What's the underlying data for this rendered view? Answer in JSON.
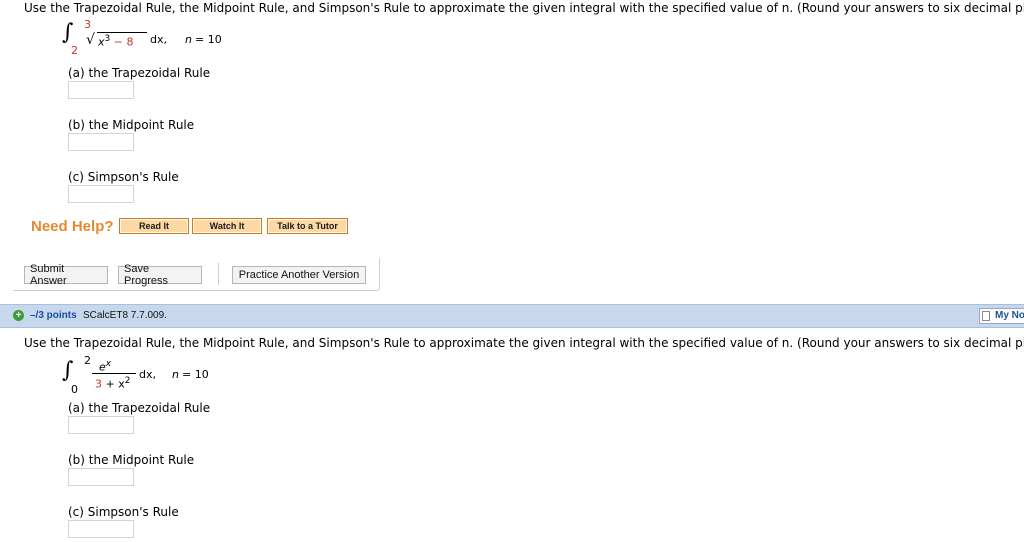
{
  "question1": {
    "instructions": "Use the Trapezoidal Rule, the Midpoint Rule, and Simpson's Rule to approximate the given integral with the specified value of n. (Round your answers to six decimal places.)",
    "integral": {
      "upper": "3",
      "lower": "2",
      "radicand_base": "x",
      "radicand_exp": "3",
      "radicand_rest": "− 8",
      "dx": "dx,",
      "n_label": "n",
      "n_eq": "= 10"
    },
    "parts": [
      {
        "label": "(a) the Trapezoidal Rule",
        "value": ""
      },
      {
        "label": "(b) the Midpoint Rule",
        "value": ""
      },
      {
        "label": "(c) Simpson's Rule",
        "value": ""
      }
    ],
    "need_help": {
      "label": "Need Help?",
      "buttons": [
        "Read It",
        "Watch It",
        "Talk to a Tutor"
      ]
    },
    "actions": {
      "submit": "Submit Answer",
      "save": "Save Progress",
      "practice": "Practice Another Version"
    }
  },
  "question2": {
    "header": {
      "points": "–/3 points",
      "code": "SCalcET8 7.7.009.",
      "my_notes": "My No"
    },
    "instructions": "Use the Trapezoidal Rule, the Midpoint Rule, and Simpson's Rule to approximate the given integral with the specified value of n. (Round your answers to six decimal places.)",
    "integral": {
      "upper": "2",
      "lower": "0",
      "numerator_base": "e",
      "numerator_exp": "x",
      "denominator_const": "3",
      "denominator_rest": "+ x",
      "denominator_exp": "2",
      "dx": "dx,",
      "n_label": "n",
      "n_eq": "= 10"
    },
    "parts": [
      {
        "label": "(a) the Trapezoidal Rule",
        "value": ""
      },
      {
        "label": "(b) the Midpoint Rule",
        "value": ""
      },
      {
        "label": "(c) Simpson's Rule",
        "value": ""
      }
    ]
  },
  "colors": {
    "need_help": "#e28b2e",
    "points": "#1b4f9c",
    "header_bg": "#c8d8ec",
    "red_value": "#c0392b"
  }
}
